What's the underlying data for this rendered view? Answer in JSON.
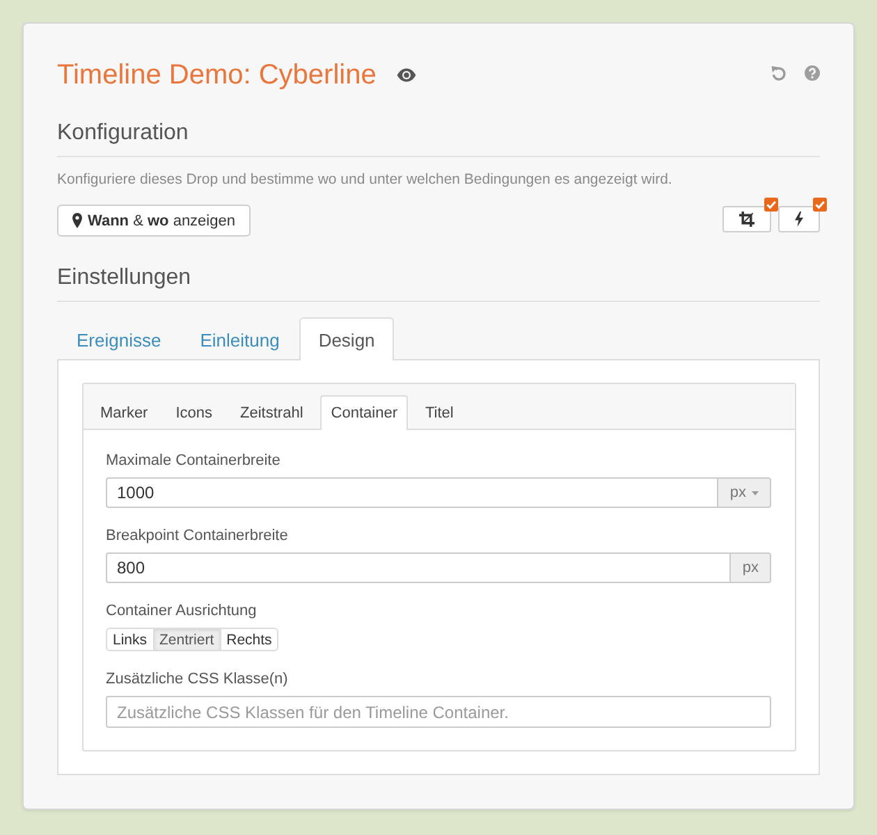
{
  "header": {
    "title": "Timeline Demo: Cyberline"
  },
  "configuration": {
    "heading": "Konfiguration",
    "description": "Konfiguriere dieses Drop und bestimme wo und unter welchen Bedingungen es angezeigt wird.",
    "button": "**Wann** & **wo** anzeigen",
    "toggles": [
      {
        "kind": "crop",
        "checked": true
      },
      {
        "kind": "bolt",
        "checked": true
      }
    ]
  },
  "settings": {
    "heading": "Einstellungen",
    "tabs": [
      {
        "label": "Ereignisse",
        "selected": false
      },
      {
        "label": "Einleitung",
        "selected": false
      },
      {
        "label": "Design",
        "selected": true
      }
    ],
    "subtabs": [
      {
        "label": "Marker",
        "selected": false
      },
      {
        "label": "Icons",
        "selected": false
      },
      {
        "label": "Zeitstrahl",
        "selected": false
      },
      {
        "label": "Container",
        "selected": true
      },
      {
        "label": "Titel",
        "selected": false
      }
    ],
    "fields": [
      {
        "kind": "input",
        "label": "Maximale Containerbreite",
        "value": "1000",
        "addon": "px",
        "dropdown": true
      },
      {
        "kind": "input",
        "label": "Breakpoint Containerbreite",
        "value": "800",
        "addon": "px",
        "dropdown": false
      },
      {
        "kind": "segmented",
        "label": "Container Ausrichtung",
        "options": [
          {
            "label": "Links",
            "selected": false
          },
          {
            "label": "Zentriert",
            "selected": true
          },
          {
            "label": "Rechts",
            "selected": false
          }
        ]
      },
      {
        "kind": "input",
        "label": "Zusätzliche CSS Klasse(n)",
        "placeholder": "Zusätzliche CSS Klassen für den Timeline Container."
      }
    ]
  }
}
